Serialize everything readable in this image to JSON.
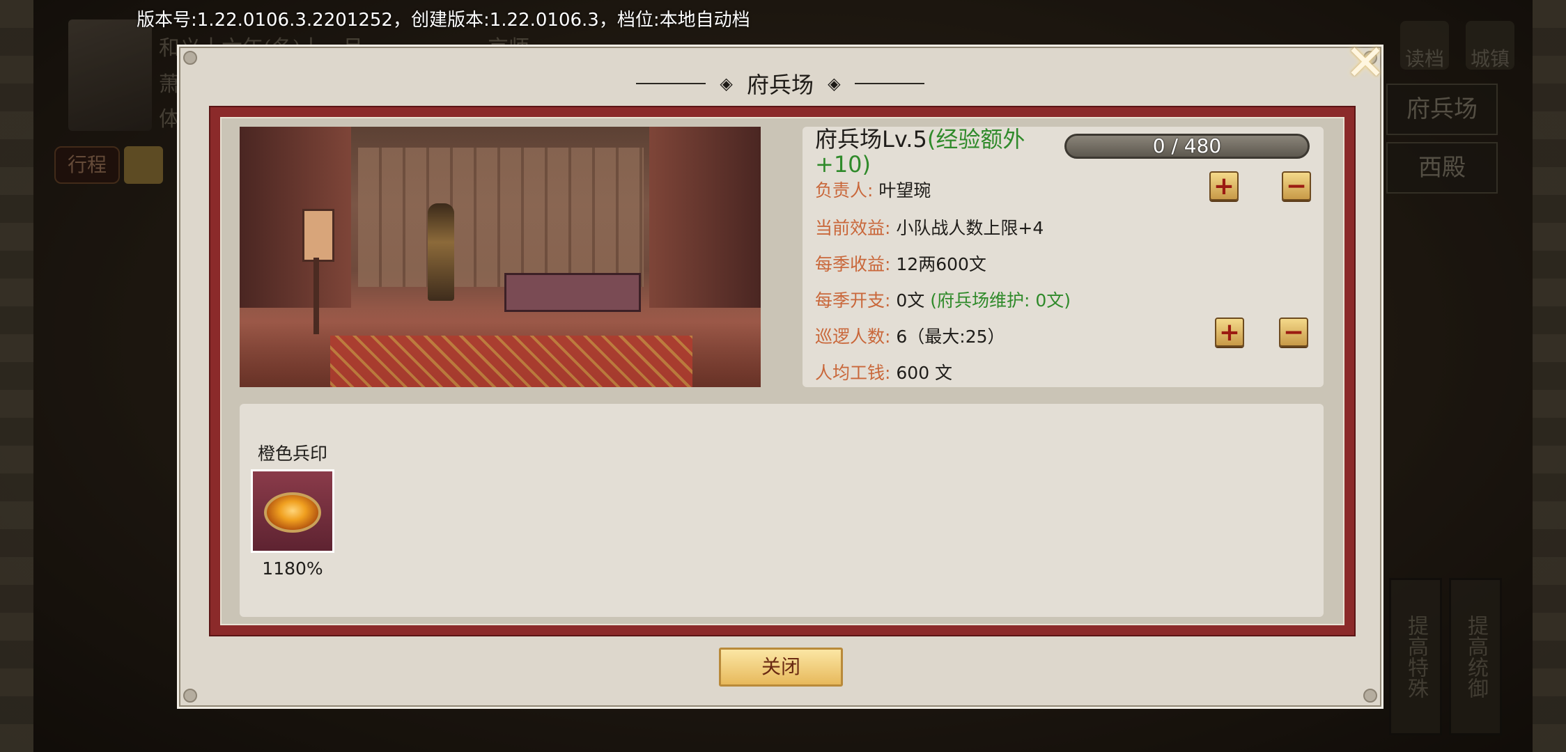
{
  "status_bar": {
    "text": "版本号:1.22.0106.3.2201252，创建版本:1.22.0106.3，档位:本地自动档"
  },
  "background": {
    "hud_lines": [
      "和义十六年(冬)十一月",
      "萧",
      "体"
    ],
    "location": "京师",
    "tag": "行程",
    "side_buttons": [
      "府兵场",
      "西殿"
    ],
    "top_icons": [
      "读档",
      "城镇"
    ],
    "vertical_buttons": [
      "提高特殊",
      "提高统御"
    ]
  },
  "dialog": {
    "title": "府兵场",
    "building": {
      "name_level": "府兵场Lv.5",
      "extra_exp": "(经验额外+10)",
      "exp_text": "0 / 480",
      "exp_fraction": 0
    },
    "rows": {
      "manager_label": "负责人:",
      "manager_value": "叶望琬",
      "effect_label": "当前效益:",
      "effect_value": "小队战人数上限+4",
      "income_label": "每季收益:",
      "income_value": "12两600文",
      "expense_label": "每季开支:",
      "expense_value": "0文",
      "expense_note": "(府兵场维护: 0文)",
      "patrol_label": "巡逻人数:",
      "patrol_value": "6（最大:25）",
      "wage_label": "人均工钱:",
      "wage_value": "600 文"
    },
    "buttons": {
      "plus": "+",
      "minus": "−",
      "close": "关闭"
    },
    "items": [
      {
        "name": "橙色兵印",
        "value": "1180%"
      }
    ]
  },
  "icons": {
    "close": "close-x-icon",
    "title_ornament": "diamond-icon"
  },
  "colors": {
    "frame": "#8b2a2a",
    "label": "#c9673a",
    "green": "#2f8a2a",
    "button": "#e7b95c"
  }
}
